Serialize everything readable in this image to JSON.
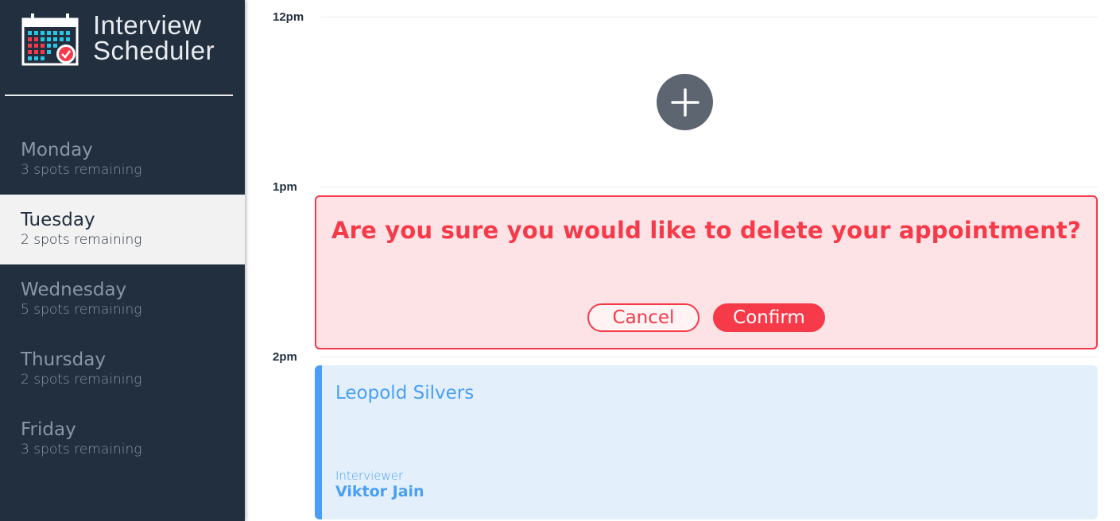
{
  "app": {
    "title_line1": "Interview",
    "title_line2": "Scheduler",
    "logo_icon": "calendar-check-icon"
  },
  "sidebar": {
    "days": [
      {
        "name": "Monday",
        "spots": "3 spots remaining",
        "selected": false
      },
      {
        "name": "Tuesday",
        "spots": "2 spots remaining",
        "selected": true
      },
      {
        "name": "Wednesday",
        "spots": "5 spots remaining",
        "selected": false
      },
      {
        "name": "Thursday",
        "spots": "2 spots remaining",
        "selected": false
      },
      {
        "name": "Friday",
        "spots": "3 spots remaining",
        "selected": false
      }
    ]
  },
  "schedule": {
    "times": [
      "12pm",
      "1pm",
      "2pm"
    ],
    "add_button_icon": "plus-icon",
    "confirm": {
      "message": "Are you sure you would like to delete your appointment?",
      "cancel_label": "Cancel",
      "confirm_label": "Confirm"
    },
    "appointment": {
      "student": "Leopold Silvers",
      "interviewer_label": "Interviewer",
      "interviewer": "Viktor Jain"
    }
  },
  "colors": {
    "sidebar_bg": "#222f3e",
    "danger": "#f63a4a",
    "danger_bg": "#fde3e5",
    "info": "#4a9ef5",
    "info_bg": "#e3f0fc",
    "add_button": "#5d6670"
  }
}
